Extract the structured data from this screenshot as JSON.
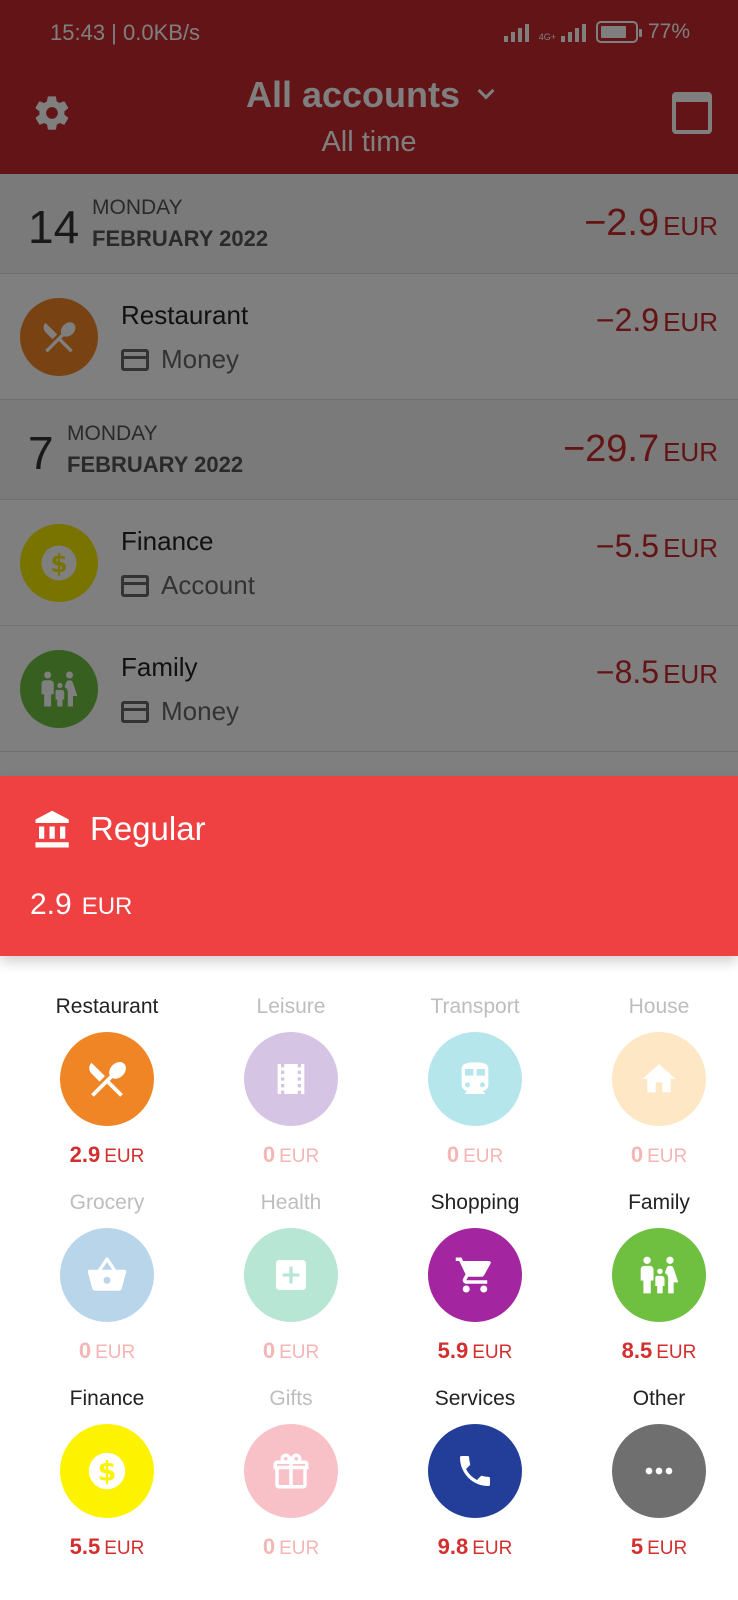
{
  "status_bar": {
    "time_speed": "15:43 | 0.0KB/s",
    "network_label": "4G+",
    "battery": "77%"
  },
  "header": {
    "account_selector": "All accounts",
    "period": "All time"
  },
  "transactions": {
    "groups": [
      {
        "day": "14",
        "weekday": "MONDAY",
        "month_year": "FEBRUARY 2022",
        "total": "−2.9",
        "currency": "EUR",
        "items": [
          {
            "name": "Restaurant",
            "account": "Money",
            "amount": "−2.9",
            "currency": "EUR",
            "icon": "fork-knife-icon",
            "color": "#f08526"
          }
        ]
      },
      {
        "day": "7",
        "weekday": "MONDAY",
        "month_year": "FEBRUARY 2022",
        "total": "−29.7",
        "currency": "EUR",
        "items": [
          {
            "name": "Finance",
            "account": "Account",
            "amount": "−5.5",
            "currency": "EUR",
            "icon": "dollar-coin-icon",
            "color": "#f2e600"
          },
          {
            "name": "Family",
            "account": "Money",
            "amount": "−8.5",
            "currency": "EUR",
            "icon": "family-icon",
            "color": "#6fbf40"
          }
        ]
      }
    ]
  },
  "sheet": {
    "title": "Regular",
    "amount": "2.9",
    "currency": "EUR",
    "color": "#ef4141",
    "icon": "bank-icon"
  },
  "categories": [
    {
      "name": "Restaurant",
      "amount": "2.9",
      "currency": "EUR",
      "color": "#f08526",
      "icon": "fork-knife-icon",
      "active": true
    },
    {
      "name": "Leisure",
      "amount": "0",
      "currency": "EUR",
      "color": "#d6c4e4",
      "icon": "film-icon",
      "active": false
    },
    {
      "name": "Transport",
      "amount": "0",
      "currency": "EUR",
      "color": "#b5e6ec",
      "icon": "train-icon",
      "active": false
    },
    {
      "name": "House",
      "amount": "0",
      "currency": "EUR",
      "color": "#fde7c4",
      "icon": "house-icon",
      "active": false
    },
    {
      "name": "Grocery",
      "amount": "0",
      "currency": "EUR",
      "color": "#b9d5ea",
      "icon": "basket-icon",
      "active": false
    },
    {
      "name": "Health",
      "amount": "0",
      "currency": "EUR",
      "color": "#b7e6d4",
      "icon": "medical-cross-icon",
      "active": false
    },
    {
      "name": "Shopping",
      "amount": "5.9",
      "currency": "EUR",
      "color": "#a3259f",
      "icon": "shopping-cart-icon",
      "active": true
    },
    {
      "name": "Family",
      "amount": "8.5",
      "currency": "EUR",
      "color": "#6fbf40",
      "icon": "family-icon",
      "active": true
    },
    {
      "name": "Finance",
      "amount": "5.5",
      "currency": "EUR",
      "color": "#fdf200",
      "icon": "dollar-coin-icon",
      "active": true
    },
    {
      "name": "Gifts",
      "amount": "0",
      "currency": "EUR",
      "color": "#f8c1c8",
      "icon": "gift-icon",
      "active": false
    },
    {
      "name": "Services",
      "amount": "9.8",
      "currency": "EUR",
      "color": "#233e99",
      "icon": "phone-icon",
      "active": true
    },
    {
      "name": "Other",
      "amount": "5",
      "currency": "EUR",
      "color": "#6f6f6f",
      "icon": "more-dots-icon",
      "active": true
    }
  ]
}
